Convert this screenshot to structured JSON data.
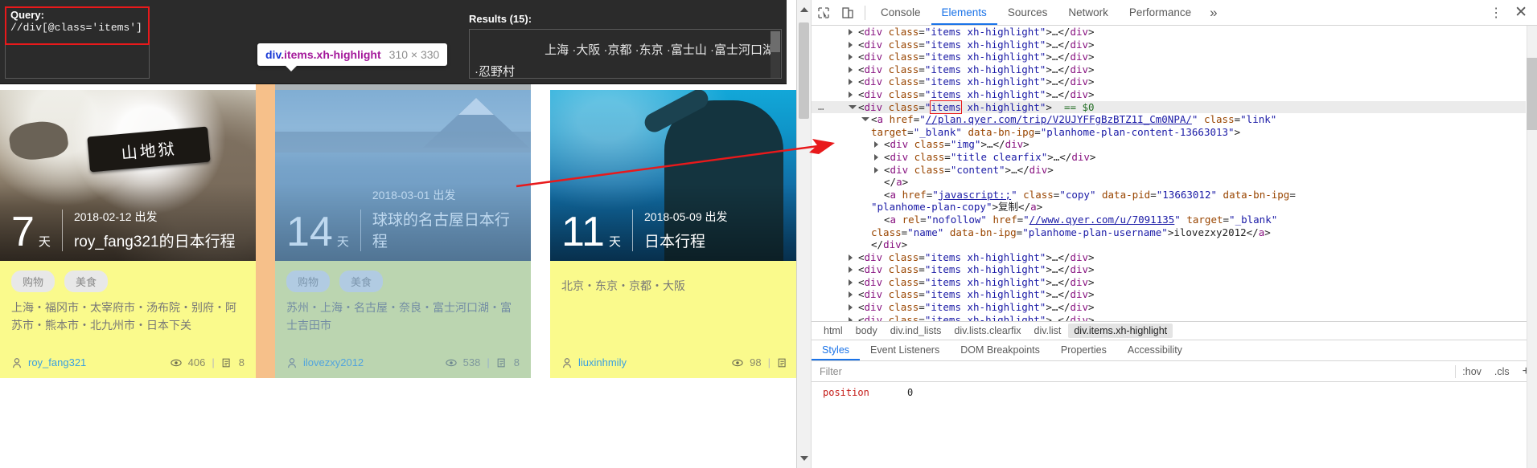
{
  "xpath_helper": {
    "query_label": "Query:",
    "query_value": "//div[@class='items']",
    "results_label": "Results (15):",
    "results_lines": [
      "上海 ·大阪 ·京都 ·东京 ·富士山 ·富士河口湖",
      "·忍野村"
    ],
    "tooltip": {
      "selector_main": "div",
      "selector_classes": ".items.xh-highlight",
      "size": "310 × 330"
    }
  },
  "cards": [
    {
      "days": "7",
      "days_unit": "天",
      "date": "2018-02-12 出发",
      "title": "roy_fang321的日本行程",
      "image_sign": "山地狱",
      "tags": [
        "购物",
        "美食"
      ],
      "route": "上海・福冈市・太宰府市・汤布院・别府・阿苏市・熊本市・北九州市・日本下关",
      "user": "roy_fang321",
      "views": "406",
      "copies": "8"
    },
    {
      "days": "14",
      "days_unit": "天",
      "date": "2018-03-01 出发",
      "title": "球球的名古屋日本行程",
      "image_sign": "",
      "tags": [
        "购物",
        "美食"
      ],
      "route": "苏州・上海・名古屋・奈良・富士河口湖・富士吉田市",
      "user": "ilovezxy2012",
      "views": "538",
      "copies": "8"
    },
    {
      "days": "11",
      "days_unit": "天",
      "date": "2018-05-09 出发",
      "title": "日本行程",
      "image_sign": "",
      "tags": [],
      "route": "北京・东京・京都・大阪",
      "user": "liuxinhmily",
      "views": "98",
      "copies": ""
    }
  ],
  "devtools": {
    "tabs": [
      "Console",
      "Elements",
      "Sources",
      "Network",
      "Performance"
    ],
    "active_tab": "Elements",
    "more_glyph": "»",
    "kebab_glyph": "⋮",
    "close_glyph": "✕",
    "dom_rows": [
      {
        "indent": 0,
        "twisty": "closed",
        "html": "<span class=\"punct\">&lt;</span><span class=\"tag-n\">div</span> <span class=\"attr-n\">class</span><span class=\"punct\">=</span><span class=\"attr-v\">\"items xh-highlight\"</span><span class=\"punct\">&gt;</span><span class=\"punct\">…&lt;/</span><span class=\"tag-n\">div</span><span class=\"punct\">&gt;</span>"
      },
      {
        "indent": 0,
        "twisty": "closed",
        "html": "<span class=\"punct\">&lt;</span><span class=\"tag-n\">div</span> <span class=\"attr-n\">class</span><span class=\"punct\">=</span><span class=\"attr-v\">\"items xh-highlight\"</span><span class=\"punct\">&gt;</span><span class=\"punct\">…&lt;/</span><span class=\"tag-n\">div</span><span class=\"punct\">&gt;</span>"
      },
      {
        "indent": 0,
        "twisty": "closed",
        "html": "<span class=\"punct\">&lt;</span><span class=\"tag-n\">div</span> <span class=\"attr-n\">class</span><span class=\"punct\">=</span><span class=\"attr-v\">\"items xh-highlight\"</span><span class=\"punct\">&gt;</span><span class=\"punct\">…&lt;/</span><span class=\"tag-n\">div</span><span class=\"punct\">&gt;</span>"
      },
      {
        "indent": 0,
        "twisty": "closed",
        "html": "<span class=\"punct\">&lt;</span><span class=\"tag-n\">div</span> <span class=\"attr-n\">class</span><span class=\"punct\">=</span><span class=\"attr-v\">\"items xh-highlight\"</span><span class=\"punct\">&gt;</span><span class=\"punct\">…&lt;/</span><span class=\"tag-n\">div</span><span class=\"punct\">&gt;</span>"
      },
      {
        "indent": 0,
        "twisty": "closed",
        "html": "<span class=\"punct\">&lt;</span><span class=\"tag-n\">div</span> <span class=\"attr-n\">class</span><span class=\"punct\">=</span><span class=\"attr-v\">\"items xh-highlight\"</span><span class=\"punct\">&gt;</span><span class=\"punct\">…&lt;/</span><span class=\"tag-n\">div</span><span class=\"punct\">&gt;</span>"
      },
      {
        "indent": 0,
        "twisty": "closed",
        "html": "<span class=\"punct\">&lt;</span><span class=\"tag-n\">div</span> <span class=\"attr-n\">class</span><span class=\"punct\">=</span><span class=\"attr-v\">\"items xh-highlight\"</span><span class=\"punct\">&gt;</span><span class=\"punct\">…&lt;/</span><span class=\"tag-n\">div</span><span class=\"punct\">&gt;</span>"
      },
      {
        "indent": 0,
        "twisty": "open",
        "selected": true,
        "dots": true,
        "html": "<span class=\"punct\">&lt;</span><span class=\"tag-n\">div</span> <span class=\"attr-n\">class</span><span class=\"punct\">=</span><span class=\"attr-v\">\"</span><span class=\"attr-v sel-box\">items</span><span class=\"attr-v\"> xh-highlight\"</span><span class=\"punct\">&gt;</span>  <span class=\"cmt\">== $0</span>"
      },
      {
        "indent": 1,
        "twisty": "open",
        "html": "<span class=\"punct\">&lt;</span><span class=\"tag-n\">a</span> <span class=\"attr-n\">href</span><span class=\"punct\">=</span><span class=\"attr-v\">\"</span><span class=\"lnk\">//plan.qyer.com/trip/V2UJYFFgBzBTZ1I_Cm0NPA/</span><span class=\"attr-v\">\"</span> <span class=\"attr-n\">class</span><span class=\"punct\">=</span><span class=\"attr-v\">\"link\"</span>"
      },
      {
        "indent": 1,
        "cont": true,
        "html": "<span class=\"attr-n\">target</span><span class=\"punct\">=</span><span class=\"attr-v\">\"_blank\"</span> <span class=\"attr-n\">data-bn-ipg</span><span class=\"punct\">=</span><span class=\"attr-v\">\"planhome-plan-content-13663013\"</span><span class=\"punct\">&gt;</span>"
      },
      {
        "indent": 2,
        "twisty": "closed",
        "html": "<span class=\"punct\">&lt;</span><span class=\"tag-n\">div</span> <span class=\"attr-n\">class</span><span class=\"punct\">=</span><span class=\"attr-v\">\"img\"</span><span class=\"punct\">&gt;…&lt;/</span><span class=\"tag-n\">div</span><span class=\"punct\">&gt;</span>"
      },
      {
        "indent": 2,
        "twisty": "closed",
        "html": "<span class=\"punct\">&lt;</span><span class=\"tag-n\">div</span> <span class=\"attr-n\">class</span><span class=\"punct\">=</span><span class=\"attr-v\">\"title clearfix\"</span><span class=\"punct\">&gt;…&lt;/</span><span class=\"tag-n\">div</span><span class=\"punct\">&gt;</span>"
      },
      {
        "indent": 2,
        "twisty": "closed",
        "html": "<span class=\"punct\">&lt;</span><span class=\"tag-n\">div</span> <span class=\"attr-n\">class</span><span class=\"punct\">=</span><span class=\"attr-v\">\"content\"</span><span class=\"punct\">&gt;…&lt;/</span><span class=\"tag-n\">div</span><span class=\"punct\">&gt;</span>"
      },
      {
        "indent": 2,
        "cont": true,
        "html": "<span class=\"punct\">&lt;/</span><span class=\"tag-n\">a</span><span class=\"punct\">&gt;</span>"
      },
      {
        "indent": 2,
        "cont": true,
        "html": "<span class=\"punct\">&lt;</span><span class=\"tag-n\">a</span> <span class=\"attr-n\">href</span><span class=\"punct\">=</span><span class=\"attr-v\">\"</span><span class=\"lnk\">javascript:;</span><span class=\"attr-v\">\"</span> <span class=\"attr-n\">class</span><span class=\"punct\">=</span><span class=\"attr-v\">\"copy\"</span> <span class=\"attr-n\">data-pid</span><span class=\"punct\">=</span><span class=\"attr-v\">\"13663012\"</span> <span class=\"attr-n\">data-bn-ipg</span><span class=\"punct\">=</span>"
      },
      {
        "indent": 1,
        "cont": true,
        "html": "<span class=\"attr-v\">\"planhome-plan-copy\"</span><span class=\"punct\">&gt;复制&lt;/</span><span class=\"tag-n\">a</span><span class=\"punct\">&gt;</span>"
      },
      {
        "indent": 2,
        "cont": true,
        "html": "<span class=\"punct\">&lt;</span><span class=\"tag-n\">a</span> <span class=\"attr-n\">rel</span><span class=\"punct\">=</span><span class=\"attr-v\">\"nofollow\"</span> <span class=\"attr-n\">href</span><span class=\"punct\">=</span><span class=\"attr-v\">\"</span><span class=\"lnk\">//www.qyer.com/u/7091135</span><span class=\"attr-v\">\"</span> <span class=\"attr-n\">target</span><span class=\"punct\">=</span><span class=\"attr-v\">\"_blank\"</span>"
      },
      {
        "indent": 1,
        "cont": true,
        "html": "<span class=\"attr-n\">class</span><span class=\"punct\">=</span><span class=\"attr-v\">\"name\"</span> <span class=\"attr-n\">data-bn-ipg</span><span class=\"punct\">=</span><span class=\"attr-v\">\"planhome-plan-username\"</span><span class=\"punct\">&gt;ilovezxy2012&lt;/</span><span class=\"tag-n\">a</span><span class=\"punct\">&gt;</span>"
      },
      {
        "indent": 1,
        "cont": true,
        "html": "<span class=\"punct\">&lt;/</span><span class=\"tag-n\">div</span><span class=\"punct\">&gt;</span>"
      },
      {
        "indent": 0,
        "twisty": "closed",
        "html": "<span class=\"punct\">&lt;</span><span class=\"tag-n\">div</span> <span class=\"attr-n\">class</span><span class=\"punct\">=</span><span class=\"attr-v\">\"items xh-highlight\"</span><span class=\"punct\">&gt;</span><span class=\"punct\">…&lt;/</span><span class=\"tag-n\">div</span><span class=\"punct\">&gt;</span>"
      },
      {
        "indent": 0,
        "twisty": "closed",
        "html": "<span class=\"punct\">&lt;</span><span class=\"tag-n\">div</span> <span class=\"attr-n\">class</span><span class=\"punct\">=</span><span class=\"attr-v\">\"items xh-highlight\"</span><span class=\"punct\">&gt;</span><span class=\"punct\">…&lt;/</span><span class=\"tag-n\">div</span><span class=\"punct\">&gt;</span>"
      },
      {
        "indent": 0,
        "twisty": "closed",
        "html": "<span class=\"punct\">&lt;</span><span class=\"tag-n\">div</span> <span class=\"attr-n\">class</span><span class=\"punct\">=</span><span class=\"attr-v\">\"items xh-highlight\"</span><span class=\"punct\">&gt;</span><span class=\"punct\">…&lt;/</span><span class=\"tag-n\">div</span><span class=\"punct\">&gt;</span>"
      },
      {
        "indent": 0,
        "twisty": "closed",
        "html": "<span class=\"punct\">&lt;</span><span class=\"tag-n\">div</span> <span class=\"attr-n\">class</span><span class=\"punct\">=</span><span class=\"attr-v\">\"items xh-highlight\"</span><span class=\"punct\">&gt;</span><span class=\"punct\">…&lt;/</span><span class=\"tag-n\">div</span><span class=\"punct\">&gt;</span>"
      },
      {
        "indent": 0,
        "twisty": "closed",
        "html": "<span class=\"punct\">&lt;</span><span class=\"tag-n\">div</span> <span class=\"attr-n\">class</span><span class=\"punct\">=</span><span class=\"attr-v\">\"items xh-highlight\"</span><span class=\"punct\">&gt;</span><span class=\"punct\">…&lt;/</span><span class=\"tag-n\">div</span><span class=\"punct\">&gt;</span>"
      },
      {
        "indent": 0,
        "twisty": "closed",
        "html": "<span class=\"punct\">&lt;</span><span class=\"tag-n\">div</span> <span class=\"attr-n\">class</span><span class=\"punct\">=</span><span class=\"attr-v\">\"items xh-highlight\"</span><span class=\"punct\">&gt;</span><span class=\"punct\">…&lt;/</span><span class=\"tag-n\">div</span><span class=\"punct\">&gt;</span>"
      }
    ],
    "breadcrumbs": [
      "html",
      "body",
      "div.ind_lists",
      "div.lists.clearfix",
      "div.list",
      "div.items.xh-highlight"
    ],
    "breadcrumb_active": "div.items.xh-highlight",
    "style_tabs": [
      "Styles",
      "Event Listeners",
      "DOM Breakpoints",
      "Properties",
      "Accessibility"
    ],
    "style_active_tab": "Styles",
    "filter_placeholder": "Filter",
    "filter_hov": ":hov",
    "filter_cls": ".cls",
    "filter_plus": "+",
    "style_rule_prop": "position",
    "style_rule_val": "0"
  },
  "colors": {
    "query_border": "#e8191b",
    "highlight_margin": "#f6c08a",
    "highlight_content": "#6fa8dc",
    "devtools_accent": "#1a73e8",
    "card_body": "#fafa8c",
    "link": "#3aa0e0"
  }
}
